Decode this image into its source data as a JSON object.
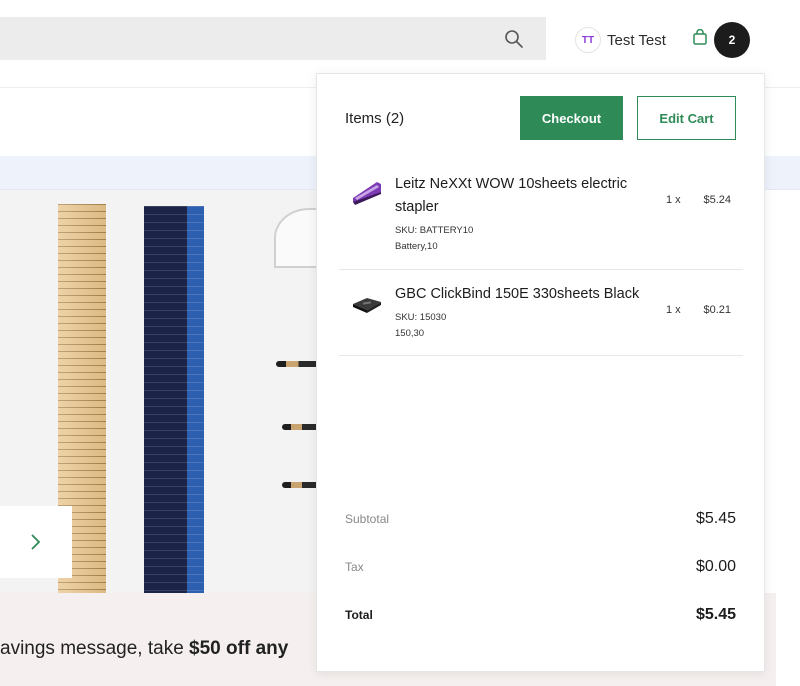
{
  "header": {
    "user_initials": "TT",
    "user_name": "Test Test",
    "cart_count": "2"
  },
  "promo": {
    "text_start": "avings message, take ",
    "text_bold": "$50 off any"
  },
  "cart": {
    "items_title": "Items (2)",
    "checkout_label": "Checkout",
    "edit_label": "Edit Cart",
    "items": [
      {
        "name": "Leitz NeXXt WOW 10sheets electric stapler",
        "sku": "SKU: BATTERY10",
        "meta": "Battery,10",
        "qty": "1 x",
        "price": "$5.24"
      },
      {
        "name": "GBC ClickBind 150E 330sheets Black",
        "sku": "SKU: 15030",
        "meta": "150,30",
        "qty": "1 x",
        "price": "$0.21"
      }
    ],
    "subtotal_label": "Subtotal",
    "subtotal_value": "$5.45",
    "tax_label": "Tax",
    "tax_value": "$0.00",
    "total_label": "Total",
    "total_value": "$5.45"
  },
  "colors": {
    "accent_green": "#2e8b57",
    "avatar_purple": "#8b3bd9",
    "badge_dark": "#1c1c1c"
  },
  "icons": [
    "search-icon",
    "shopping-bag-icon",
    "chevron-right-icon",
    "stapler-image",
    "binder-image"
  ]
}
